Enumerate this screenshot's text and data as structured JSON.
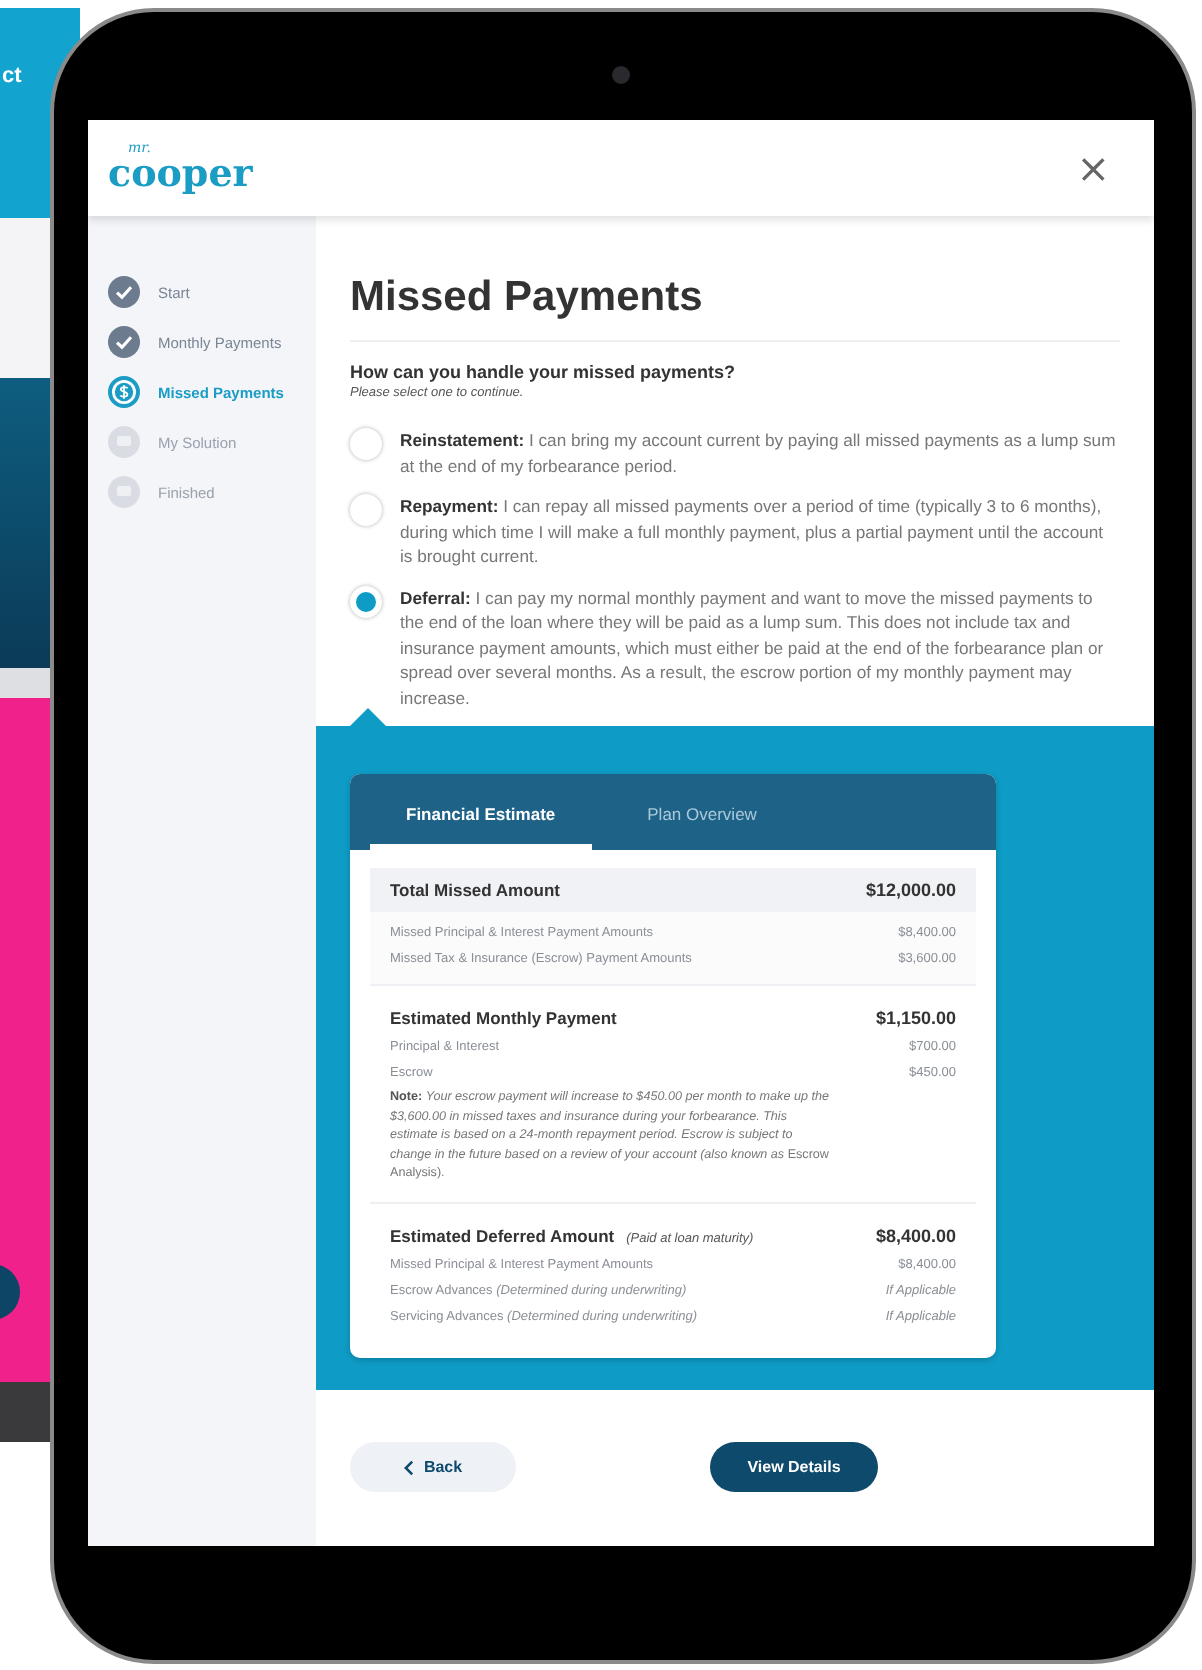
{
  "background_device": {
    "text": "ct"
  },
  "header": {
    "logo_small": "mr.",
    "logo": "cooper",
    "close": "×"
  },
  "steps": [
    {
      "label": "Start",
      "completed": true,
      "selected": false
    },
    {
      "label": "Monthly Payments",
      "completed": true,
      "selected": false
    },
    {
      "label": "Missed Payments",
      "completed": false,
      "selected": true
    },
    {
      "label": "My Solution",
      "completed": false,
      "selected": false
    },
    {
      "label": "Finished",
      "completed": false,
      "selected": false
    }
  ],
  "title": "Missed Payments",
  "question": "How can you handle your missed payments?",
  "hint": "Please select one to continue.",
  "options": [
    {
      "text": "**Reinstatement:** I can bring my account current by paying all missed payments as a lump sum at the end of my forbearance period.",
      "selected": false
    },
    {
      "text": "**Repayment:** I can repay all missed payments over a period of time (typically 3 to 6 months), during which time I will make a full monthly payment, plus a partial payment until the account is brought current.",
      "selected": false
    },
    {
      "text": "**Deferral:** I can pay my normal monthly payment and want to move the missed payments to the end of the loan where they will be paid as a lump sum. This does not include tax and insurance payment amounts, which must either be paid at the end of the forbearance plan or spread over several months. As a result, the escrow portion of my monthly payment may increase.",
      "selected": true
    }
  ],
  "card": {
    "tabs": [
      {
        "label": "Financial Estimate",
        "selected": true
      },
      {
        "label": "Plan Overview",
        "selected": false
      }
    ],
    "sections": [
      {
        "shaded": true,
        "label": "Total Missed Amount",
        "total": "$12,000.00",
        "rows": [
          {
            "label": "Missed Principal & Interest Payment Amounts",
            "value": "$8,400.00",
            "kind": "amount"
          },
          {
            "label": "Missed Tax & Insurance (Escrow) Payment Amounts",
            "value": "$3,600.00",
            "kind": "amount"
          }
        ]
      },
      {
        "shaded": false,
        "label": "Estimated Monthly Payment",
        "total": "$1,150.00",
        "rows": [
          {
            "label": "Principal & Interest",
            "value": "$700.00",
            "kind": "amount"
          },
          {
            "label": "Escrow",
            "value": "$450.00",
            "kind": "amount"
          }
        ],
        "note": "**Note:** *Your escrow payment will increase to $450.00 per month to make up the $3,600.00 in missed taxes and insurance during your forbearance. This estimate is based on a 24-month repayment period. Escrow is subject to change in the future based on a review of your account (also known as* Escrow Analysis)."
      },
      {
        "shaded": false,
        "label": "Estimated Deferred Amount",
        "qualifier": "(Paid at loan maturity)",
        "total": "$8,400.00",
        "rows": [
          {
            "label": "Missed Principal & Interest Payment Amounts",
            "value": "$8,400.00",
            "kind": "amount"
          },
          {
            "label": "Escrow Advances *(Determined during underwriting)*",
            "value": "If Applicable",
            "kind": "pending"
          },
          {
            "label": "Servicing Advances *(Determined during underwriting)*",
            "value": "If Applicable",
            "kind": "pending"
          }
        ]
      }
    ]
  },
  "buttons": {
    "back": "Back",
    "next": "View Details"
  }
}
